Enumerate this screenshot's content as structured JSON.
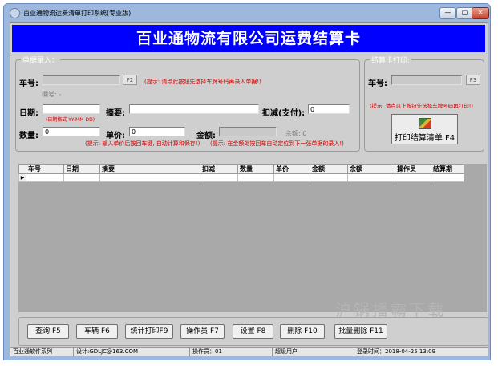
{
  "window": {
    "title": "百业通物流运费清单打印系统(专业版)",
    "controls": {
      "minimize": "—",
      "maximize": "▢",
      "close": "✕"
    }
  },
  "banner": {
    "title": "百业通物流有限公司运费结算卡"
  },
  "entry": {
    "legend": "单据录入：",
    "car_label": "车号:",
    "car_key": "F2",
    "car_hint": "(提示: 请点此按钮先选择车牌号码再录入单据!)",
    "number_label": "编号: -",
    "date_label": "日期:",
    "date_hint": "(日期格式 YY-MM-DD)",
    "summary_label": "摘要:",
    "deduct_label": "扣减(支付):",
    "deduct_value": "0",
    "qty_label": "数量:",
    "qty_value": "0",
    "price_label": "单价:",
    "price_value": "0",
    "amount_label": "金额:",
    "balance_label": "余额: 0",
    "calc_hint": "(提示: 输入单价后按回车键, 自动计算和保存!)",
    "amount_hint": "(提示: 在金额处按回车自动定位到下一张单据的录入!)"
  },
  "settle": {
    "legend": "结算卡打印:",
    "car_label": "车号:",
    "car_key": "F3",
    "hint": "(提示: 请点以上按钮先选择车牌号码再打印!)",
    "print_button": "打印结算清单 F4"
  },
  "grid": {
    "columns": [
      "车号",
      "日期",
      "摘要",
      "扣减",
      "数量",
      "单价",
      "金额",
      "余额",
      "操作员",
      "结算期"
    ],
    "row_marker": "▶"
  },
  "watermark": "沪锅播霸下载",
  "buttons": {
    "query": "查询 F5",
    "vehicle": "车辆 F6",
    "stats_print": "统计打印F9",
    "operator": "操作员 F7",
    "settings": "设置 F8",
    "delete": "删除 F10",
    "batch_delete": "批量删除 F11"
  },
  "status": {
    "product": "百业通软件系列",
    "design": "设计:GDLJC@163.COM",
    "operator": "操作员：01",
    "role": "超级用户",
    "login_time": "登录时间：2018-04-25  13:09"
  }
}
